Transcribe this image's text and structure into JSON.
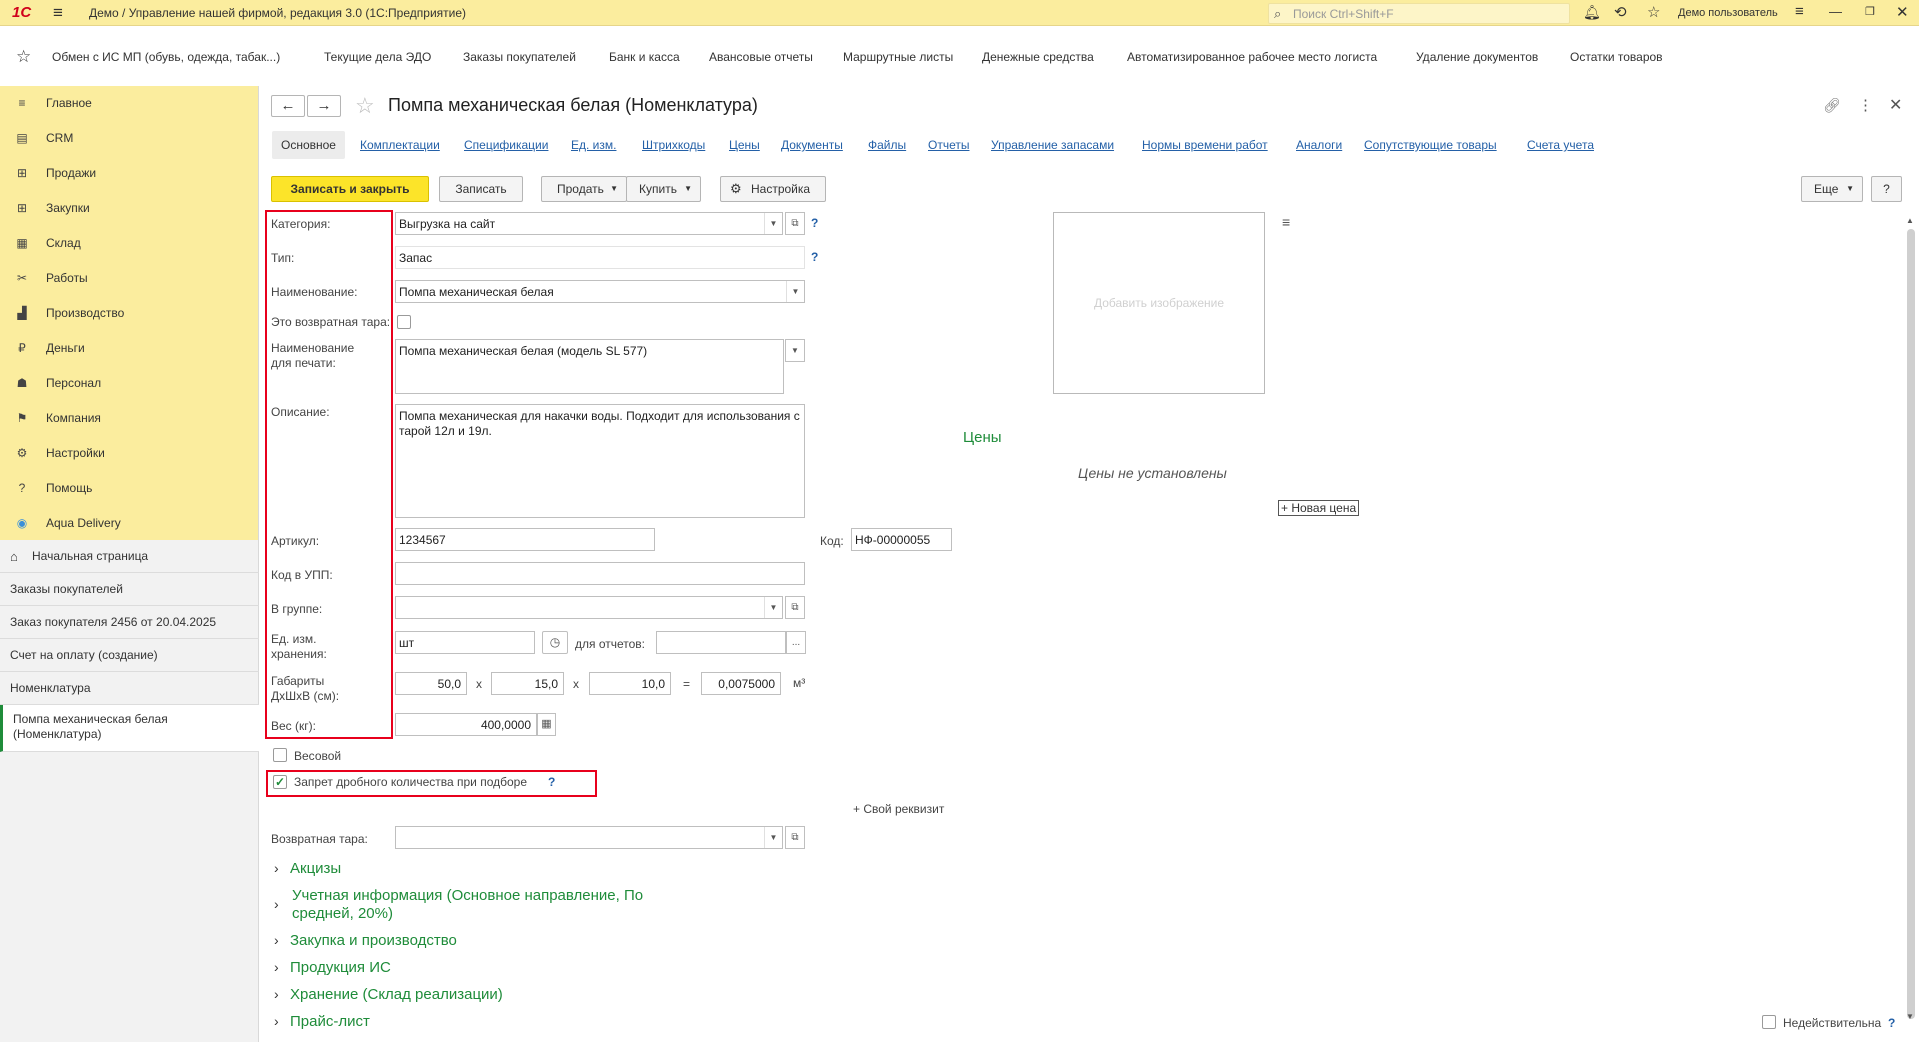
{
  "titlebar": {
    "logo": "1С",
    "title": "Демо / Управление нашей фирмой, редакция 3.0  (1С:Предприятие)",
    "search_placeholder": "Поиск Ctrl+Shift+F",
    "user": "Демо пользователь"
  },
  "favbar": {
    "items": [
      "Обмен с ИС МП (обувь, одежда, табак...)",
      "Текущие дела ЭДО",
      "Заказы покупателей",
      "Банк и касса",
      "Авансовые отчеты",
      "Маршрутные листы",
      "Денежные средства",
      "Автоматизированное рабочее место логиста",
      "Удаление документов",
      "Остатки товаров"
    ]
  },
  "sidebar": {
    "items": [
      {
        "label": "Главное",
        "icon": "≡"
      },
      {
        "label": "CRM",
        "icon": "▤"
      },
      {
        "label": "Продажи",
        "icon": "⊞"
      },
      {
        "label": "Закупки",
        "icon": "⊞"
      },
      {
        "label": "Склад",
        "icon": "▦"
      },
      {
        "label": "Работы",
        "icon": "✂"
      },
      {
        "label": "Производство",
        "icon": "▟"
      },
      {
        "label": "Деньги",
        "icon": "₽"
      },
      {
        "label": "Персонал",
        "icon": "☗"
      },
      {
        "label": "Компания",
        "icon": "⚑"
      },
      {
        "label": "Настройки",
        "icon": "⚙"
      },
      {
        "label": "Помощь",
        "icon": "?"
      },
      {
        "label": "Aqua Delivery",
        "icon": "◉"
      }
    ],
    "open": [
      "Начальная страница",
      "Заказы покупателей",
      "Заказ покупателя 2456 от 20.04.2025",
      "Счет на оплату (создание)",
      "Номенклатура",
      "Помпа механическая белая (Номенклатура)"
    ]
  },
  "form": {
    "title": "Помпа механическая белая (Номенклатура)",
    "tabs": [
      "Основное",
      "Комплектации",
      "Спецификации",
      "Ед. изм.",
      "Штрихкоды",
      "Цены",
      "Документы",
      "Файлы",
      "Отчеты",
      "Управление запасами",
      "Нормы времени работ",
      "Аналоги",
      "Сопутствующие товары",
      "Счета учета"
    ],
    "buttons": {
      "save_close": "Записать и закрыть",
      "save": "Записать",
      "sell": "Продать",
      "buy": "Купить",
      "settings": "Настройка",
      "more": "Еще",
      "help": "?"
    },
    "labels": {
      "category": "Категория:",
      "type": "Тип:",
      "name": "Наименование:",
      "returnable": "Это возвратная тара:",
      "print_name": "Наименование для печати:",
      "description": "Описание:",
      "article": "Артикул:",
      "code": "Код:",
      "upp": "Код в УПП:",
      "group": "В группе:",
      "unit": "Ед. изм. хранения:",
      "for_reports": "для отчетов:",
      "dims": "Габариты ДхШхВ (см):",
      "weight": "Вес (кг):",
      "weighable": "Весовой",
      "fractional": "Запрет дробного количества при подборе",
      "own_attr": "+ Свой реквизит",
      "return_tare": "Возвратная тара:",
      "x": "x",
      "eq": "=",
      "m3": "м³"
    },
    "values": {
      "category": "Выгрузка на сайт",
      "type": "Запас",
      "name": "Помпа механическая белая",
      "print_name": "Помпа механическая белая (модель SL 577)",
      "description": "Помпа механическая для накачки воды. Подходит для использования с тарой 12л и 19л.",
      "article": "1234567",
      "code": "НФ-00000055",
      "upp": "",
      "group": "",
      "unit": "шт",
      "for_reports": "",
      "length": "50,0",
      "width": "15,0",
      "height": "10,0",
      "volume": "0,0075000",
      "weight": "400,0000",
      "return_tare": ""
    },
    "state": {
      "returnable": false,
      "weighable": false,
      "fractional": true,
      "inactive": false
    },
    "image_placeholder": "Добавить изображение",
    "prices": {
      "title": "Цены",
      "empty": "Цены не установлены",
      "new": "+ Новая цена"
    },
    "sections": [
      "Акцизы",
      "Учетная информация (Основное направление, По средней, 20%)",
      "Закупка и производство",
      "Продукция ИС",
      "Хранение (Склад реализации)",
      "Прайс-лист"
    ],
    "inactive": "Недействительна",
    "help_mark": "?"
  }
}
